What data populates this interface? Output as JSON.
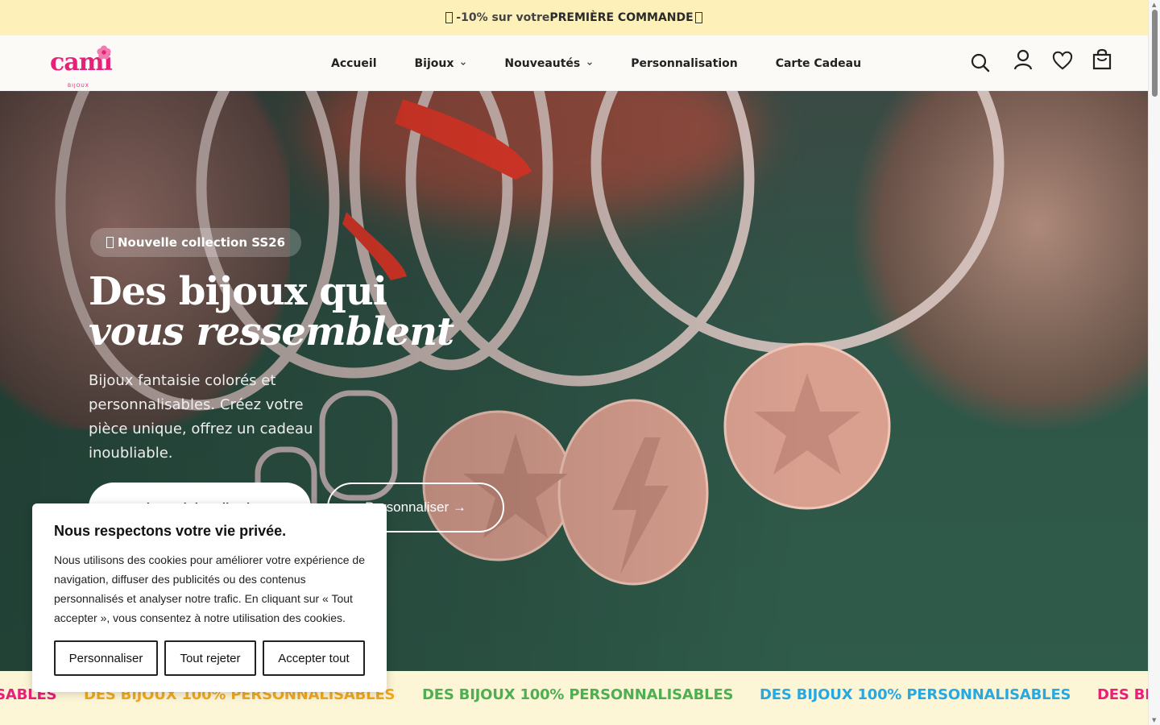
{
  "announcement": {
    "icon_left": "\u0000",
    "prefix": "-10% sur votre ",
    "bold": "PREMIÈRE COMMANDE",
    "icon_right": "\u0000"
  },
  "logo": {
    "word": "cami",
    "sub": "BIJOUX"
  },
  "nav": [
    {
      "label": "Accueil",
      "dropdown": false
    },
    {
      "label": "Bijoux",
      "dropdown": true
    },
    {
      "label": "Nouveautés",
      "dropdown": true
    },
    {
      "label": "Personnalisation",
      "dropdown": false
    },
    {
      "label": "Carte Cadeau",
      "dropdown": false
    }
  ],
  "header_icons": [
    "search-icon",
    "account-icon",
    "wishlist-heart-icon",
    "cart-bag-icon"
  ],
  "hero": {
    "badge": "Nouvelle collection SS26",
    "badge_icon": "\u0000",
    "headline_line1": "Des bijoux qui",
    "headline_line2": "vous ressemblent",
    "subtitle": "Bijoux fantaisie colorés et personnalisables. Créez votre pièce unique, offrez un cadeau inoubliable.",
    "primary_button": "Découvrir la collection",
    "secondary_button": "Personnaliser →"
  },
  "marquee": {
    "text": "DES BIJOUX 100% PERSONNALISABLES",
    "colors": [
      "#e8207a",
      "#f2a81d",
      "#4caf50",
      "#29a8e0",
      "#e8207a"
    ]
  },
  "cookie": {
    "title": "Nous respectons votre vie privée.",
    "body": "Nous utilisons des cookies pour améliorer votre expérience de navigation, diffuser des publicités ou des contenus personnalisés et analyser notre trafic. En cliquant sur « Tout accepter », vous consentez à notre utilisation des cookies.",
    "btn_customize": "Personnaliser",
    "btn_reject": "Tout rejeter",
    "btn_accept": "Accepter tout"
  },
  "colors": {
    "brand_pink": "#e8207a",
    "announcement_bg": "#fdf0b8",
    "marquee_bg": "#fdf6d6"
  }
}
